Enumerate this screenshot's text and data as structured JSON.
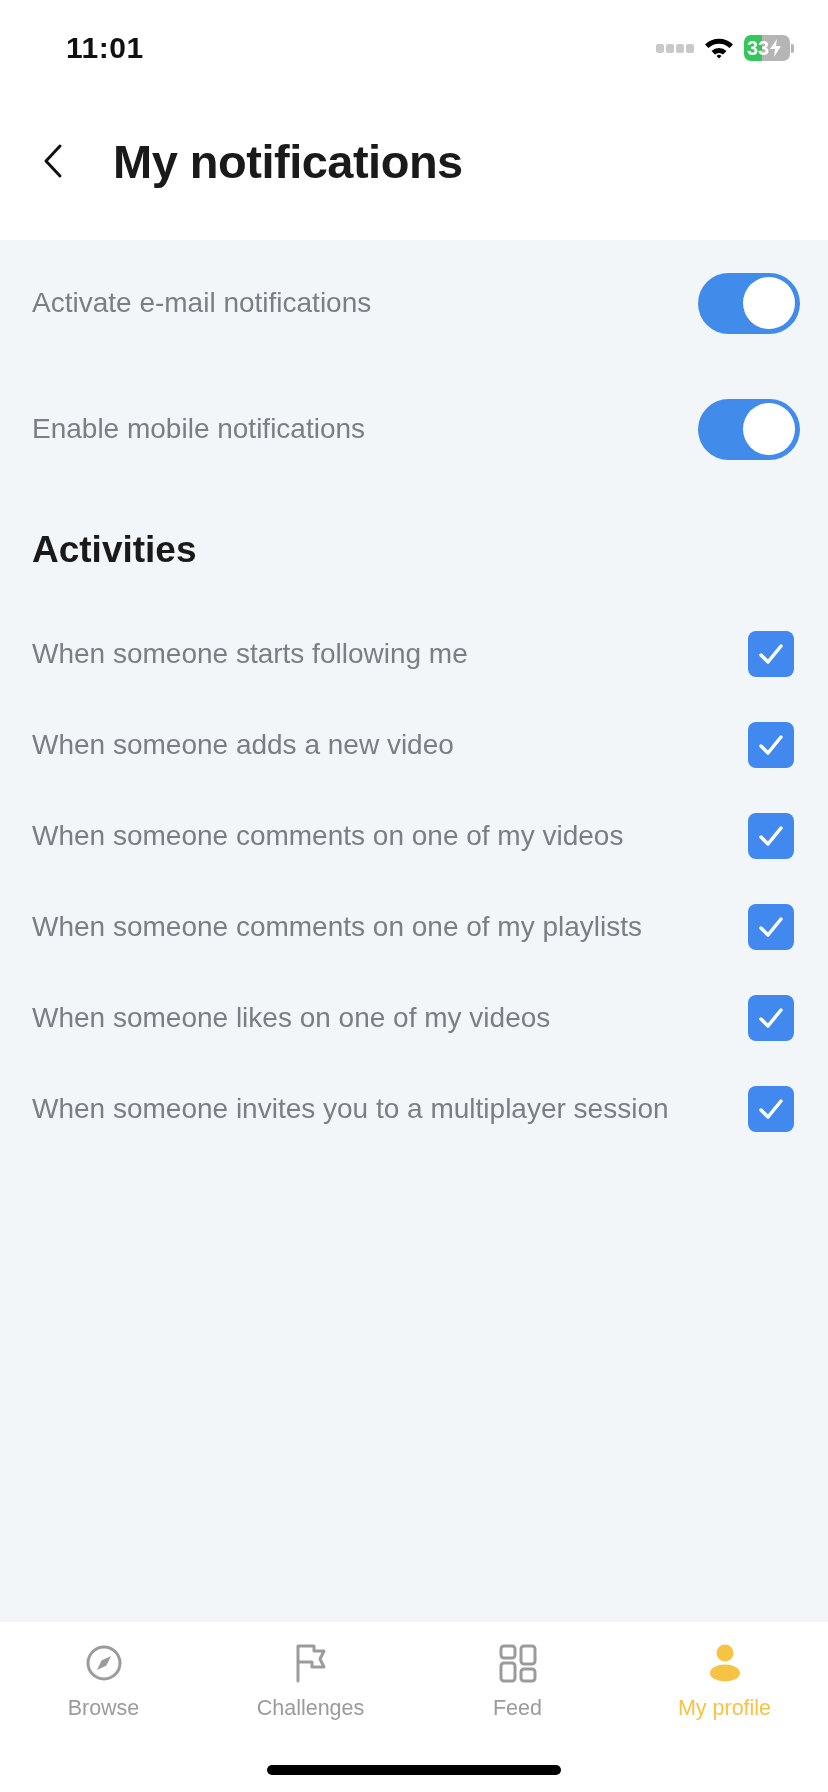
{
  "status_bar": {
    "time": "11:01",
    "battery": "33"
  },
  "header": {
    "title": "My notifications"
  },
  "toggles": [
    {
      "label": "Activate e-mail notifications",
      "on": true
    },
    {
      "label": "Enable mobile notifications",
      "on": true
    }
  ],
  "activities": {
    "heading": "Activities",
    "items": [
      {
        "label": "When someone starts following me",
        "checked": true
      },
      {
        "label": "When someone adds a new video",
        "checked": true
      },
      {
        "label": "When someone comments on one of my videos",
        "checked": true
      },
      {
        "label": "When someone comments on one of my playlists",
        "checked": true
      },
      {
        "label": "When someone likes on one of my videos",
        "checked": true
      },
      {
        "label": "When someone invites you to a multiplayer session",
        "checked": true
      }
    ]
  },
  "tab_bar": [
    {
      "label": "Browse",
      "selected": false
    },
    {
      "label": "Challenges",
      "selected": false
    },
    {
      "label": "Feed",
      "selected": false
    },
    {
      "label": "My profile",
      "selected": true
    }
  ]
}
